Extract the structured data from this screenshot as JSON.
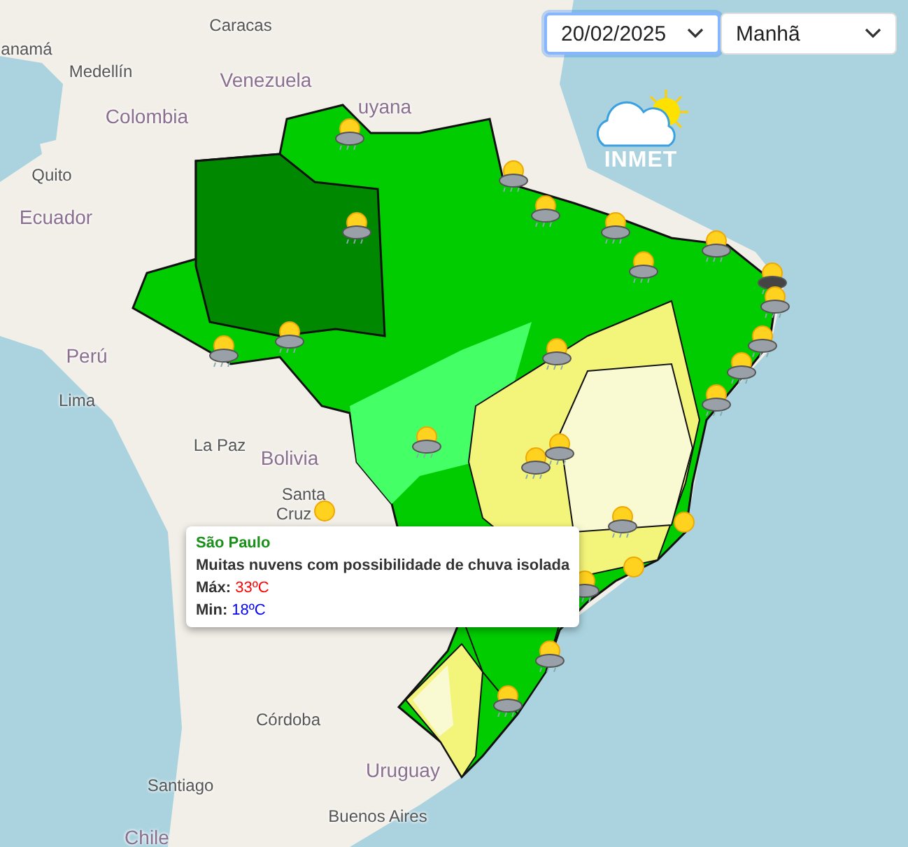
{
  "map_labels": [
    "Caracas",
    "anamá",
    "Medellín",
    "Venezuela",
    "Colombia",
    "uyana",
    "Quito",
    "Ecuador",
    "Perú",
    "Lima",
    "La Paz",
    "Bolivia",
    "Santa",
    "Cruz",
    "Córdoba",
    "Uruguay",
    "Santiago",
    "Buenos Aires",
    "Chile"
  ],
  "weather_markers": [
    {
      "kind": "sun_rain"
    },
    {
      "kind": "sun_rain"
    },
    {
      "kind": "sun_rain"
    },
    {
      "kind": "sun_rain"
    },
    {
      "kind": "sun_rain"
    },
    {
      "kind": "sun_rain"
    },
    {
      "kind": "sun_rain"
    },
    {
      "kind": "storm"
    },
    {
      "kind": "sun_rain"
    },
    {
      "kind": "sun_rain"
    },
    {
      "kind": "sun_rain"
    },
    {
      "kind": "sun_rain"
    },
    {
      "kind": "sun_rain"
    },
    {
      "kind": "sun_rain"
    },
    {
      "kind": "sun_rain"
    },
    {
      "kind": "sun_rain"
    },
    {
      "kind": "sun_rain"
    },
    {
      "kind": "sun_rain"
    },
    {
      "kind": "sun_rain"
    },
    {
      "kind": "sun"
    },
    {
      "kind": "sun"
    },
    {
      "kind": "sun_rain"
    },
    {
      "kind": "sun_rain"
    },
    {
      "kind": "sun_rain"
    },
    {
      "kind": "sun"
    }
  ],
  "filters": {
    "date": "20/02/2025",
    "period": "Manhã"
  },
  "logo": {
    "text": "INMET"
  },
  "tooltip": {
    "title": "São Paulo",
    "description": "Muitas nuvens com possibilidade de chuva isolada",
    "max_label": "Máx:",
    "max_value": "33ºC",
    "min_label": "Min:",
    "min_value": "18ºC"
  }
}
